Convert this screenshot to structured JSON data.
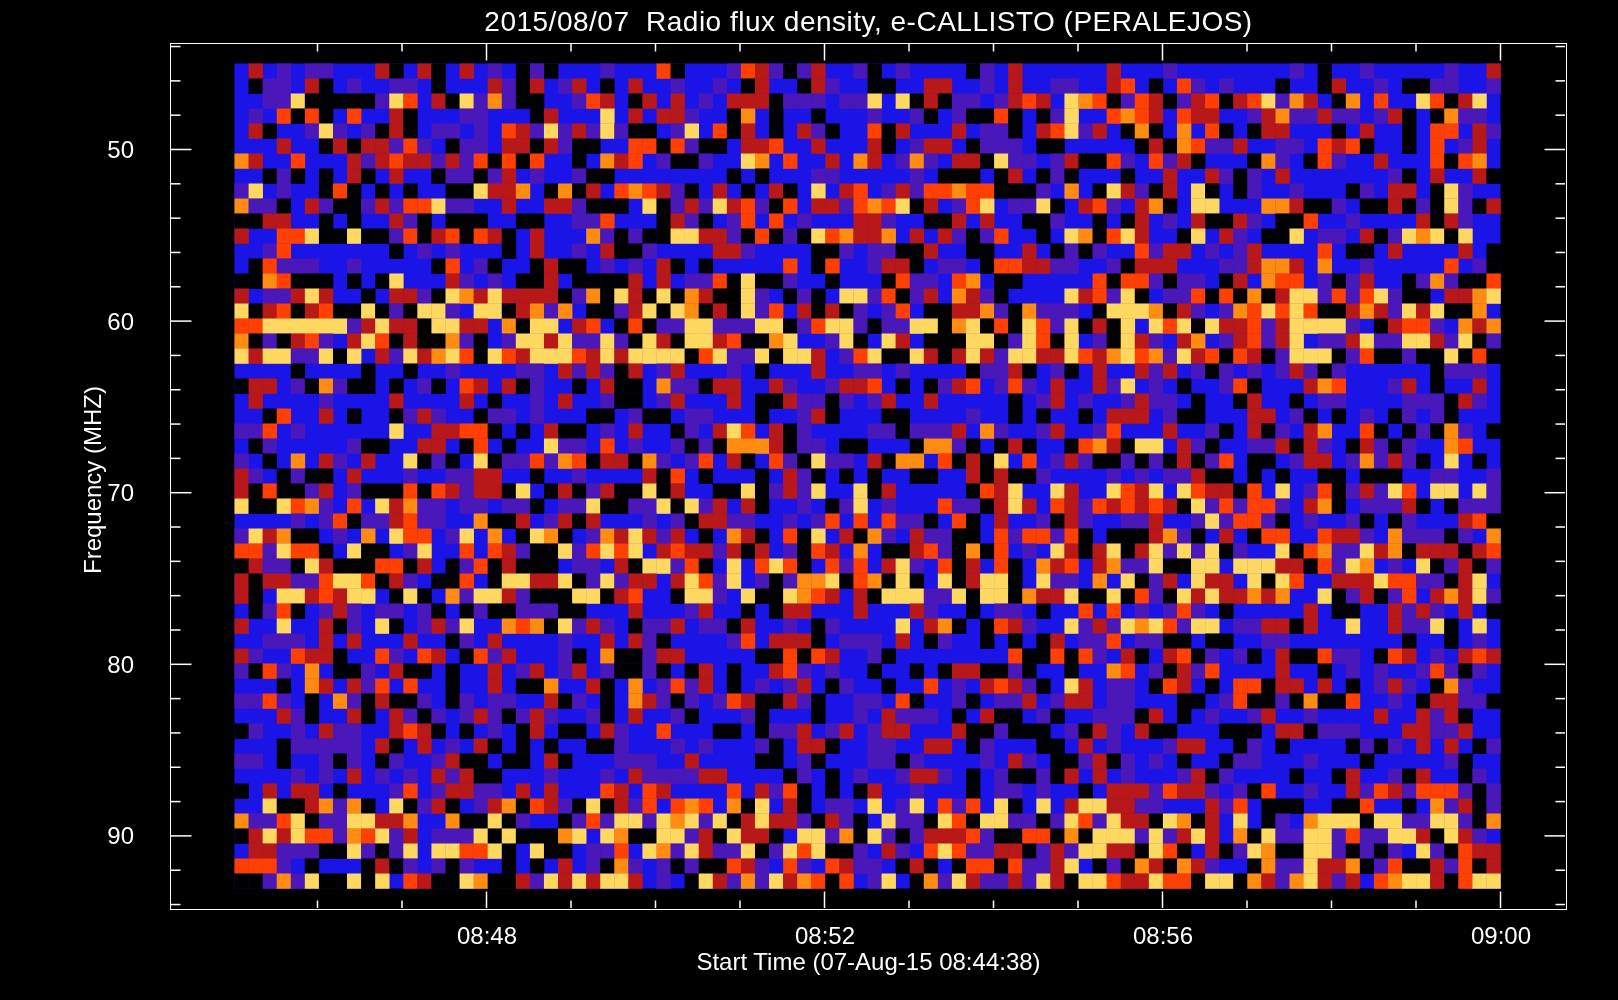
{
  "title": "2015/08/07  Radio flux density, e-CALLISTO (PERALEJOS)",
  "y_axis": {
    "label": "Frequency (MHZ)",
    "ticks": [
      "50",
      "60",
      "70",
      "80",
      "90"
    ]
  },
  "x_axis": {
    "label": "Start Time (07-Aug-15 08:44:38)",
    "ticks": [
      "08:48",
      "08:52",
      "08:56",
      "09:00"
    ]
  }
}
